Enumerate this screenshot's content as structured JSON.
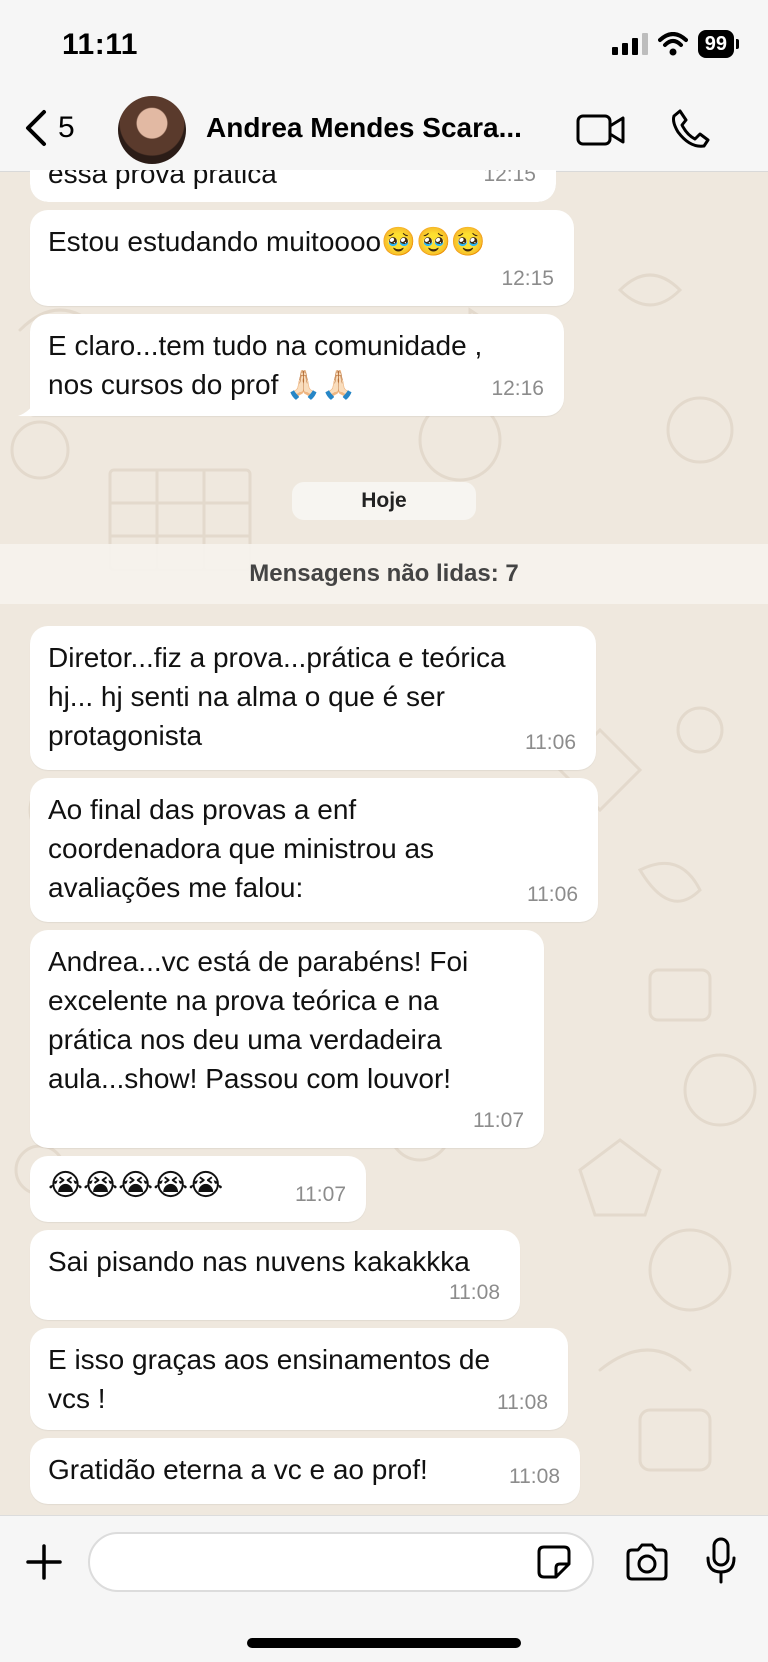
{
  "status_bar": {
    "time": "11:11",
    "battery": "99"
  },
  "header": {
    "back_count": "5",
    "contact_name": "Andrea Mendes Scara..."
  },
  "messages": [
    {
      "text": "essa prova prática",
      "time": "12:15"
    },
    {
      "text": "Estou estudando muitoooo🥹🥹🥹",
      "time": "12:15"
    },
    {
      "text": "E claro...tem tudo na comunidade ,\nnos cursos do prof 🙏🏻🙏🏻",
      "time": "12:16"
    },
    {
      "text": "Diretor...fiz a prova...prática e teórica\nhj... hj senti na alma o que é ser\nprotagonista",
      "time": "11:06"
    },
    {
      "text": "Ao final das provas a enf\ncoordenadora que ministrou as\navaliações me falou:",
      "time": "11:06"
    },
    {
      "text": "Andrea...vc está de parabéns! Foi\nexcelente na prova teórica e na\nprática nos deu uma verdadeira\naula...show! Passou com louvor!",
      "time": "11:07"
    },
    {
      "text": "😭😭😭😭😭",
      "time": "11:07"
    },
    {
      "text": "Sai pisando nas nuvens kakakkka",
      "time": "11:08"
    },
    {
      "text": "E isso graças aos ensinamentos de\nvcs !",
      "time": "11:08"
    },
    {
      "text": "Gratidão eterna a vc e ao prof!",
      "time": "11:08"
    }
  ],
  "date_separator": "Hoje",
  "unread_label": "Mensagens não lidas: 7",
  "input": {
    "placeholder": ""
  },
  "icons": {
    "back": "chevron-left-icon",
    "video": "video-camera-icon",
    "call": "phone-icon",
    "plus": "plus-icon",
    "sticker": "sticker-icon",
    "camera": "camera-icon",
    "mic": "microphone-icon"
  },
  "colors": {
    "bubble": "#ffffff",
    "chat_background": "#efe8de",
    "bar_background": "#f6f6f6"
  }
}
